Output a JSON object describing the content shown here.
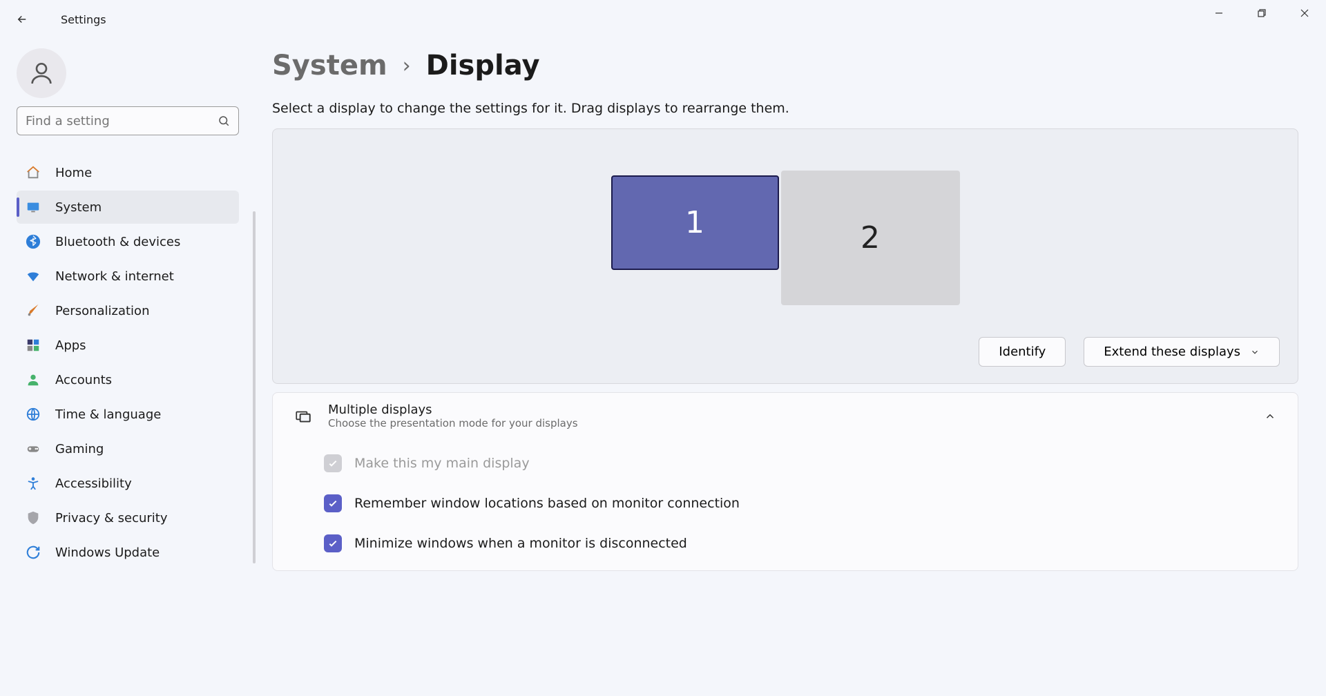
{
  "app_title": "Settings",
  "search_placeholder": "Find a setting",
  "breadcrumb": {
    "parent": "System",
    "current": "Display"
  },
  "display_intro": "Select a display to change the settings for it. Drag displays to rearrange them.",
  "monitors": {
    "primary": "1",
    "secondary": "2"
  },
  "identify_label": "Identify",
  "extend_label": "Extend these displays",
  "multiple_displays": {
    "title": "Multiple displays",
    "subtitle": "Choose the presentation mode for your displays"
  },
  "checks": {
    "main": "Make this my main display",
    "remember": "Remember window locations based on monitor connection",
    "minimize": "Minimize windows when a monitor is disconnected"
  },
  "nav": {
    "home": "Home",
    "system": "System",
    "bluetooth": "Bluetooth & devices",
    "network": "Network & internet",
    "personalization": "Personalization",
    "apps": "Apps",
    "accounts": "Accounts",
    "time": "Time & language",
    "gaming": "Gaming",
    "accessibility": "Accessibility",
    "privacy": "Privacy & security",
    "update": "Windows Update"
  }
}
